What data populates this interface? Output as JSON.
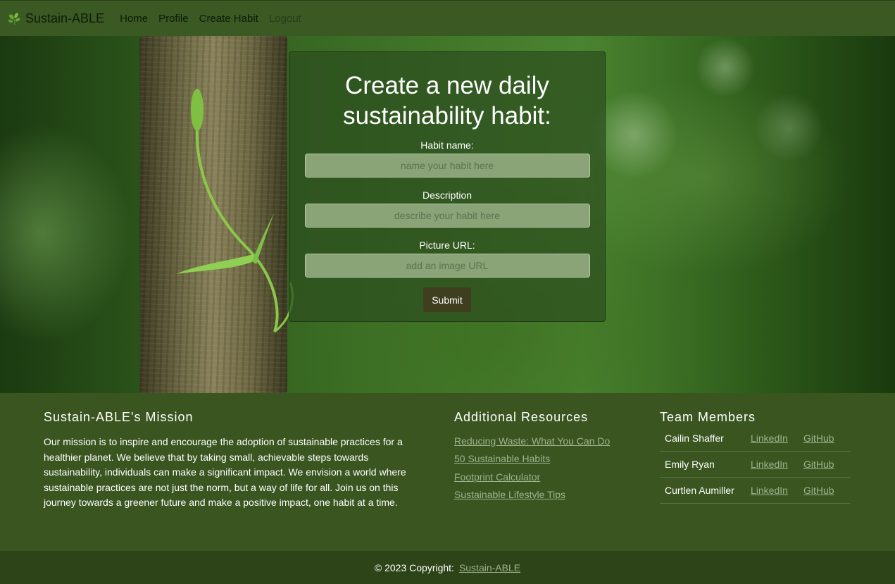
{
  "navbar": {
    "brand": "Sustain-ABLE",
    "brand_icon": "leaf-icon",
    "links": [
      "Home",
      "Profile",
      "Create Habit",
      "Logout"
    ]
  },
  "form": {
    "title_line1": "Create a new daily",
    "title_line2": "sustainability habit:",
    "habit_name_label": "Habit name:",
    "habit_name_placeholder": "name your habit here",
    "description_label": "Description",
    "description_placeholder": "describe your habit here",
    "picture_label": "Picture URL:",
    "picture_placeholder": "add an image URL",
    "submit_label": "Submit"
  },
  "footer": {
    "mission_title": "Sustain-ABLE's Mission",
    "mission_text": "Our mission is to inspire and encourage the adoption of sustainable practices for a healthier planet. We believe that by taking small, achievable steps towards sustainability, individuals can make a significant impact. We envision a world where sustainable practices are not just the norm, but a way of life for all. Join us on this journey towards a greener future and make a positive impact, one habit at a time.",
    "resources_title": "Additional Resources",
    "resources": [
      "Reducing Waste: What You Can Do",
      "50 Sustainable Habits",
      "Footprint Calculator",
      "Sustainable Lifestyle Tips"
    ],
    "team_title": "Team Members",
    "team": [
      {
        "name": "Cailin Shaffer",
        "linkedin": "LinkedIn",
        "github": "GitHub"
      },
      {
        "name": "Emily Ryan",
        "linkedin": "LinkedIn",
        "github": "GitHub"
      },
      {
        "name": "Curtlen Aumiller",
        "linkedin": "LinkedIn",
        "github": "GitHub"
      }
    ],
    "copyright_text": "© 2023 Copyright:",
    "copyright_link": "Sustain-ABLE"
  },
  "colors": {
    "navbar": "#3b5a23",
    "footer": "#3a5520",
    "copyright_bar": "#2c4417",
    "link": "#9fb28f",
    "submit": "#3f3f1f"
  }
}
